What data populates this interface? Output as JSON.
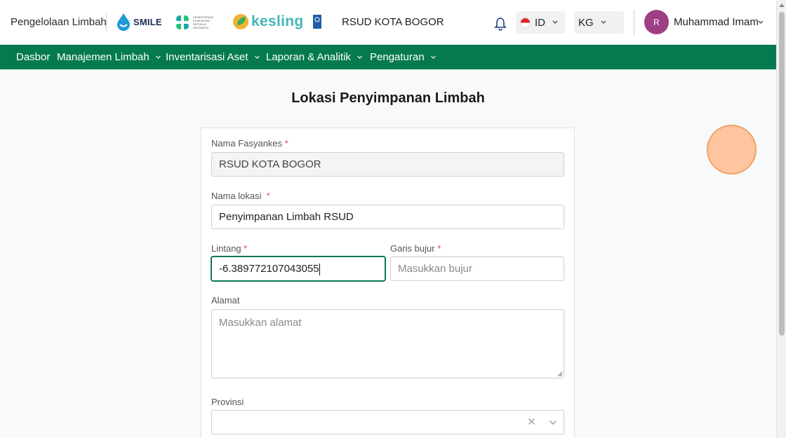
{
  "header": {
    "app_title": "Pengelolaan Limbah",
    "logos": {
      "smile": "SMILE",
      "kemenkes": "KEMENTERIAN KESEHATAN REPUBLIK INDONESIA",
      "kesling": "kesling"
    },
    "facility": "RSUD KOTA BOGOR",
    "language": "ID",
    "unit": "KG",
    "user": {
      "initial": "R",
      "name": "Muhammad Imam"
    }
  },
  "nav": {
    "items": [
      {
        "label": "Dasbor",
        "has_dropdown": false
      },
      {
        "label": "Manajemen Limbah",
        "has_dropdown": true
      },
      {
        "label": "Inventarisasi Aset",
        "has_dropdown": true
      },
      {
        "label": "Laporan & Analitik",
        "has_dropdown": true
      },
      {
        "label": "Pengaturan",
        "has_dropdown": true
      }
    ]
  },
  "main": {
    "title": "Lokasi Penyimpanan Limbah",
    "form": {
      "facility_label": "Nama Fasyankes",
      "facility_value": "RSUD KOTA BOGOR",
      "location_label": "Nama lokasi",
      "location_value": "Penyimpanan Limbah RSUD",
      "latitude_label": "Lintang",
      "latitude_value": "-6.389772107043055",
      "longitude_label": "Garis bujur",
      "longitude_placeholder": "Masukkan bujur",
      "address_label": "Alamat",
      "address_placeholder": "Masukkan alamat",
      "province_label": "Provinsi",
      "province_value": ""
    },
    "required_mark": "*"
  },
  "colors": {
    "nav_bg": "#057a4f",
    "focus": "#0a7a52",
    "required": "#e04848",
    "avatar": "#9c3f84"
  },
  "icons": [
    "bell-icon",
    "flag-id-icon",
    "chevron-down-icon",
    "clear-icon",
    "resize-handle-icon"
  ]
}
